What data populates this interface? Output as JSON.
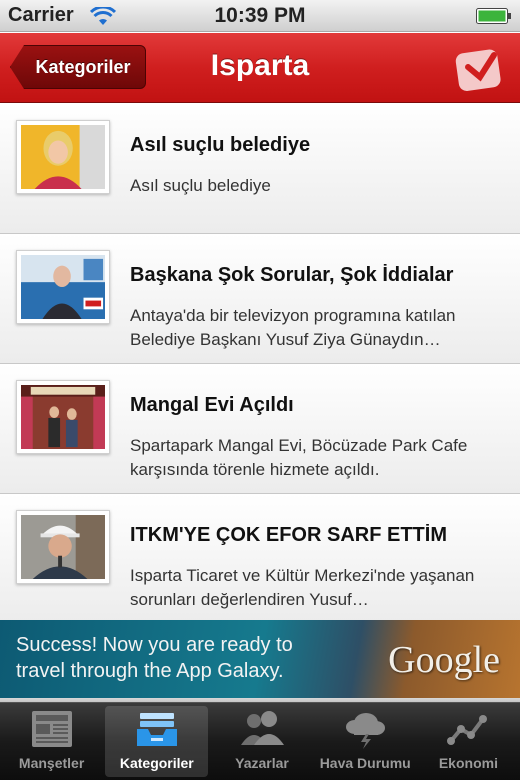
{
  "status_bar": {
    "carrier": "Carrier",
    "time": "10:39 PM"
  },
  "nav": {
    "back_label": "Kategoriler",
    "title": "Isparta",
    "accent_color": "#d01f1f"
  },
  "news": [
    {
      "title": "Asıl suçlu belediye",
      "summary": "Asıl suçlu belediye"
    },
    {
      "title": "Başkana Şok Sorular, Şok İddialar",
      "summary": "Antaya'da bir televizyon programına katılan Belediye Başkanı Yusuf Ziya Günaydın…"
    },
    {
      "title": "Mangal Evi Açıldı",
      "summary": "Spartapark Mangal Evi, Böcüzade Park Cafe karşısında törenle hizmete açıldı."
    },
    {
      "title": "ITKM'YE ÇOK EFOR SARF ETTİM",
      "summary": "Isparta Ticaret ve Kültür Merkezi'nde yaşanan sorunları değerlendiren Yusuf…"
    }
  ],
  "ad": {
    "text": "Success! Now you are ready to travel through the App Galaxy.",
    "brand": "Google"
  },
  "tabs": [
    {
      "label": "Manşetler",
      "icon": "newspaper-icon",
      "active": false
    },
    {
      "label": "Kategoriler",
      "icon": "inbox-tray-icon",
      "active": true
    },
    {
      "label": "Yazarlar",
      "icon": "people-icon",
      "active": false
    },
    {
      "label": "Hava Durumu",
      "icon": "weather-cloud-icon",
      "active": false
    },
    {
      "label": "Ekonomi",
      "icon": "line-chart-icon",
      "active": false
    }
  ]
}
